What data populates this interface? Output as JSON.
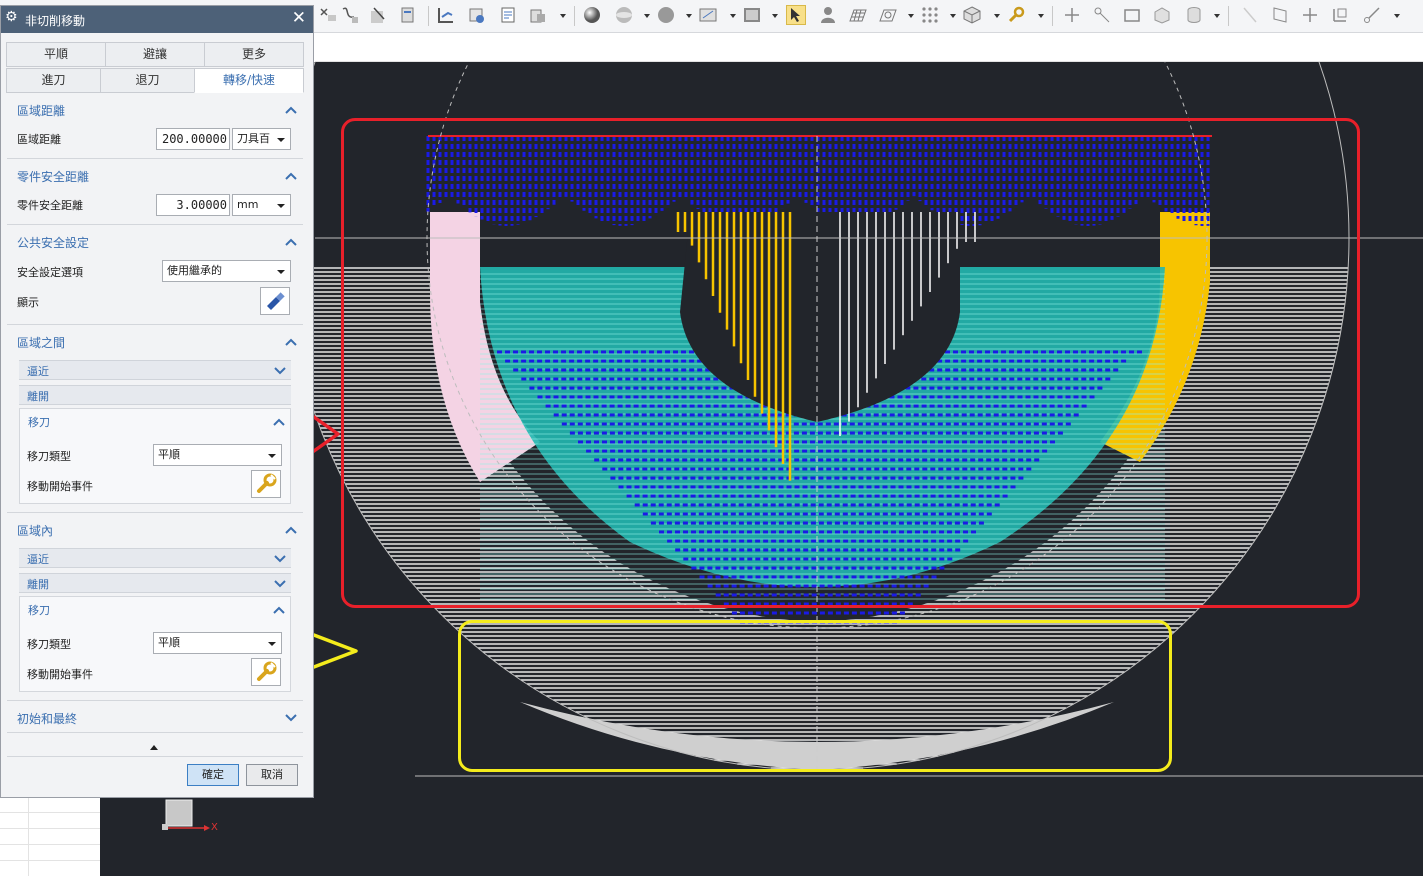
{
  "dialog": {
    "title": "非切削移動",
    "tabs_row1": [
      "平順",
      "避讓",
      "更多"
    ],
    "tabs_row2": [
      "進刀",
      "退刀",
      "轉移/快速"
    ],
    "active_tab": "轉移/快速",
    "region_distance": {
      "header": "區域距離",
      "label": "區域距離",
      "value": "200.00000",
      "unit": "刀具百"
    },
    "part_safe_clearance": {
      "header": "零件安全距離",
      "label": "零件安全距離",
      "value": "3.00000",
      "unit": "mm"
    },
    "common_clearance": {
      "header": "公共安全設定",
      "option_label": "安全設定選項",
      "option_value": "使用繼承的",
      "display_label": "顯示"
    },
    "between_regions": {
      "header": "區域之間",
      "approach": "逼近",
      "departure": "離開",
      "traverse_header": "移刀",
      "traverse_type_label": "移刀類型",
      "traverse_type_value": "平順",
      "start_event_label": "移動開始事件"
    },
    "within_regions": {
      "header": "區域內",
      "approach": "逼近",
      "departure": "離開",
      "traverse_header": "移刀",
      "traverse_type_label": "移刀類型",
      "traverse_type_value": "平順",
      "start_event_label": "移動開始事件"
    },
    "initial_final": {
      "header": "初始和最終"
    },
    "ok_label": "確定",
    "cancel_label": "取消"
  },
  "viewport": {
    "axis_label": "X",
    "background": "#22252b",
    "annotation_colors": {
      "red_frame": "#e8202a",
      "yellow_frame": "#f4ec1c"
    }
  },
  "icons": {
    "gear": "gear-icon",
    "close": "close-icon",
    "flashlight": "flashlight-icon",
    "wrench": "wrench-icon",
    "collapse": "chevron-up-icon",
    "expand": "chevron-down-icon"
  }
}
